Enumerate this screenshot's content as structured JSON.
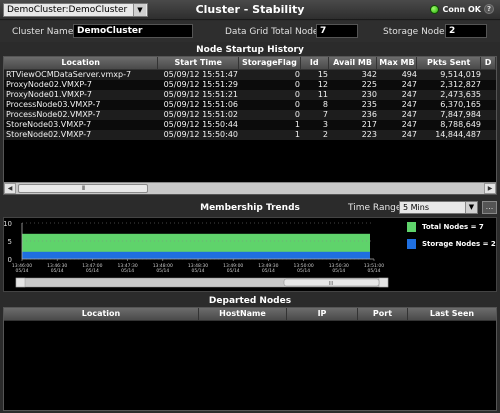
{
  "topbar": {
    "cluster_selector": "DemoCluster:DemoCluster",
    "title": "Cluster - Stability",
    "connection_status": "Conn OK",
    "help": "?"
  },
  "info": {
    "cluster_name_label": "Cluster Name:",
    "cluster_name_value": "DemoCluster",
    "total_nodes_label": "Data Grid Total Nodes",
    "total_nodes_value": "7",
    "storage_nodes_label": "Storage Nodes",
    "storage_nodes_value": "2"
  },
  "node_history": {
    "title": "Node Startup History",
    "columns": [
      "Location",
      "Start Time",
      "StorageFlag",
      "Id",
      "Avail MB",
      "Max MB",
      "Pkts Sent",
      "D"
    ],
    "rows": [
      [
        "RTViewOCMDataServer.vmxp-7",
        "05/09/12 15:51:47",
        "0",
        "15",
        "342",
        "494",
        "9,514,019"
      ],
      [
        "ProxyNode02.VMXP-7",
        "05/09/12 15:51:29",
        "0",
        "12",
        "225",
        "247",
        "2,312,827"
      ],
      [
        "ProxyNode01.VMXP-7",
        "05/09/12 15:51:21",
        "0",
        "11",
        "230",
        "247",
        "2,473,635"
      ],
      [
        "ProcessNode03.VMXP-7",
        "05/09/12 15:51:06",
        "0",
        "8",
        "235",
        "247",
        "6,370,165"
      ],
      [
        "ProcessNode02.VMXP-7",
        "05/09/12 15:51:02",
        "0",
        "7",
        "236",
        "247",
        "7,847,984"
      ],
      [
        "StoreNode03.VMXP-7",
        "05/09/12 15:50:44",
        "1",
        "3",
        "217",
        "247",
        "8,788,649"
      ],
      [
        "StoreNode02.VMXP-7",
        "05/09/12 15:50:40",
        "1",
        "2",
        "223",
        "247",
        "14,844,487"
      ]
    ],
    "scroll_thumb": "III"
  },
  "trends": {
    "title": "Membership Trends",
    "time_range_label": "Time Range:",
    "time_range_value": "5 Mins",
    "more_button": "...",
    "scroll_thumb": "III"
  },
  "chart_data": {
    "type": "area",
    "title": "Membership Trends",
    "ylim": [
      0,
      10
    ],
    "y_ticks": [
      "10",
      "5",
      "0"
    ],
    "x_tick_labels": [
      [
        "13:46:00",
        "05/14"
      ],
      [
        "13:46:30",
        "05/14"
      ],
      [
        "13:47:00",
        "05/14"
      ],
      [
        "13:47:30",
        "05/14"
      ],
      [
        "13:48:00",
        "05/14"
      ],
      [
        "13:48:30",
        "05/14"
      ],
      [
        "13:49:00",
        "05/14"
      ],
      [
        "13:49:30",
        "05/14"
      ],
      [
        "13:50:00",
        "05/14"
      ],
      [
        "13:50:30",
        "05/14"
      ],
      [
        "13:51:00",
        "05/14"
      ]
    ],
    "series": [
      {
        "name": "Total Nodes = 7",
        "value": 7,
        "color": "#5fd36b"
      },
      {
        "name": "Storage Nodes = 2",
        "value": 2,
        "color": "#1f6fe0"
      }
    ],
    "grid": true
  },
  "departed": {
    "title": "Departed Nodes",
    "columns": [
      "Location",
      "HostName",
      "IP",
      "Port",
      "Last Seen"
    ]
  }
}
